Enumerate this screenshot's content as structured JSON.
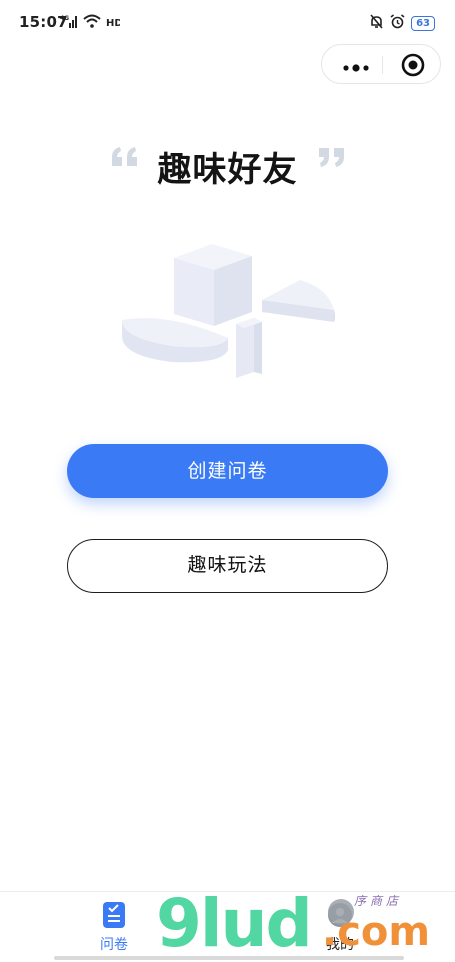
{
  "status_bar": {
    "time": "15:07",
    "network": "4G",
    "wifi_badge": "HD",
    "battery": "63",
    "icons": [
      "signal-icon",
      "wifi-icon",
      "hd-icon",
      "mute-bell-icon",
      "alarm-icon",
      "battery-icon"
    ]
  },
  "capsule": {
    "icons": [
      "more-icon",
      "close-icon"
    ]
  },
  "page": {
    "title": "趣味好友"
  },
  "buttons": {
    "primary": "创建问卷",
    "secondary": "趣味玩法"
  },
  "tab_bar": {
    "tabs": [
      {
        "label": "问卷",
        "icon": "questionnaire-icon",
        "active": true
      },
      {
        "label": "我的",
        "icon": "user-icon",
        "active": false
      }
    ]
  },
  "watermark": {
    "logo": "9lud",
    "suffix": ".com",
    "shop": "序商店"
  },
  "colors": {
    "accent": "#3a7bf5",
    "watermark_green": "#52d6a2",
    "watermark_orange": "#f0913a"
  }
}
